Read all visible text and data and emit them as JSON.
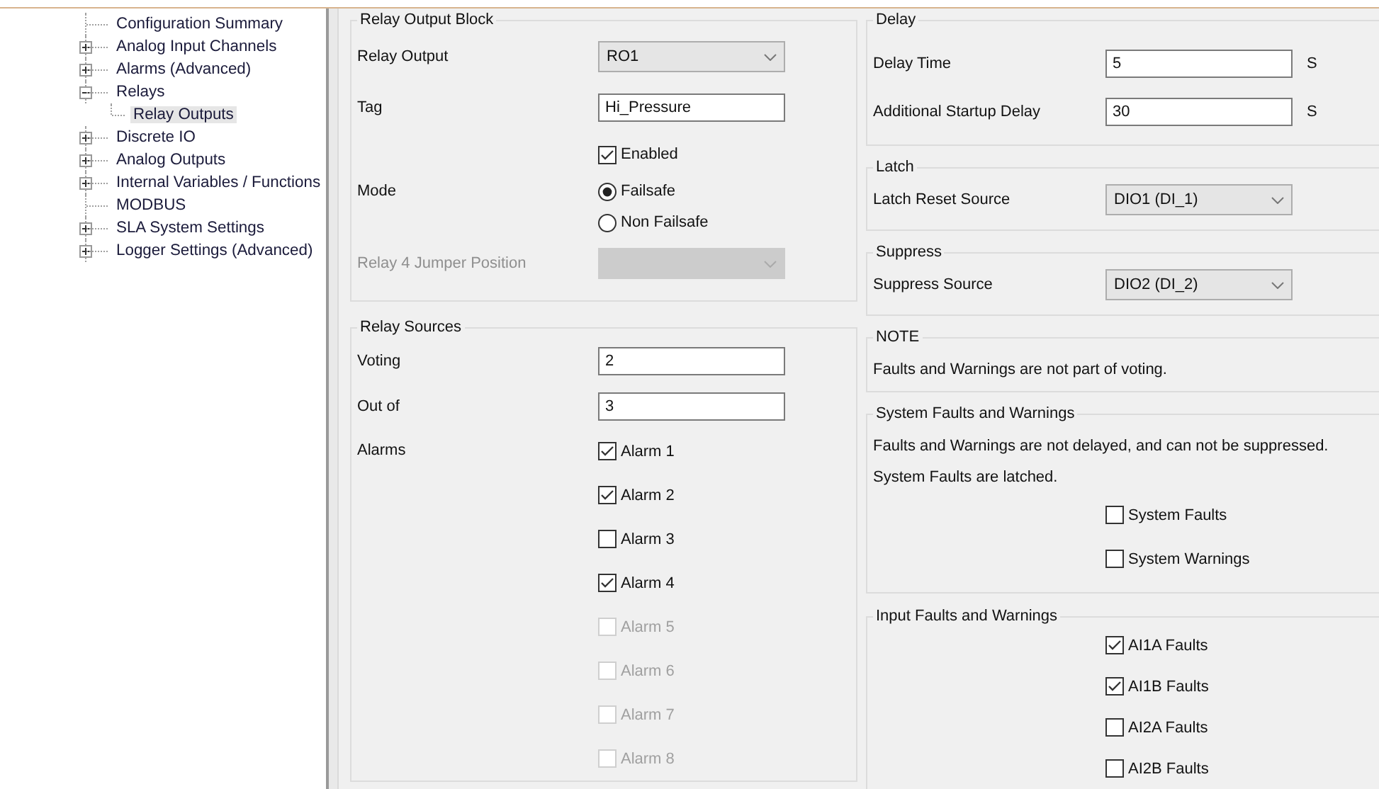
{
  "tree": [
    {
      "label": "Configuration Summary",
      "kind": "leaf",
      "selected": false
    },
    {
      "label": "Analog Input Channels",
      "kind": "node",
      "expanded": false,
      "selected": false
    },
    {
      "label": "Alarms (Advanced)",
      "kind": "node",
      "expanded": false,
      "selected": false
    },
    {
      "label": "Relays",
      "kind": "node",
      "expanded": true,
      "selected": false,
      "children": [
        {
          "label": "Relay Outputs",
          "kind": "leaf",
          "selected": true
        }
      ]
    },
    {
      "label": "Discrete IO",
      "kind": "node",
      "expanded": false,
      "selected": false
    },
    {
      "label": "Analog Outputs",
      "kind": "node",
      "expanded": false,
      "selected": false
    },
    {
      "label": "Internal Variables / Functions",
      "kind": "node",
      "expanded": false,
      "selected": false
    },
    {
      "label": "MODBUS",
      "kind": "leaf",
      "selected": false
    },
    {
      "label": "SLA System Settings",
      "kind": "node",
      "expanded": false,
      "selected": false
    },
    {
      "label": "Logger Settings (Advanced)",
      "kind": "node",
      "expanded": false,
      "selected": false
    }
  ],
  "left_groups": [
    {
      "title": "Relay Output Block",
      "rows": [
        {
          "kind": "select",
          "label": "Relay Output",
          "value": "RO1",
          "disabled": false
        },
        {
          "kind": "text",
          "label": "Tag",
          "value": "Hi_Pressure"
        },
        {
          "kind": "checks",
          "items": [
            {
              "text": "Enabled",
              "checked": true,
              "disabled": false
            }
          ]
        },
        {
          "kind": "radio",
          "label": "Mode",
          "options": [
            {
              "text": "Failsafe",
              "selected": true
            },
            {
              "text": "Non Failsafe",
              "selected": false
            }
          ]
        },
        {
          "kind": "select",
          "label": "Relay 4 Jumper Position",
          "disabled": true
        }
      ]
    },
    {
      "title": "Relay Sources",
      "rows": [
        {
          "kind": "text",
          "label": "Voting",
          "value": "2"
        },
        {
          "kind": "text",
          "label": "Out of",
          "value": "3"
        },
        {
          "kind": "checks",
          "label": "Alarms",
          "items": [
            {
              "text": "Alarm 1",
              "checked": true,
              "disabled": false
            },
            {
              "text": "Alarm 2",
              "checked": true,
              "disabled": false
            },
            {
              "text": "Alarm 3",
              "checked": false,
              "disabled": false
            },
            {
              "text": "Alarm 4",
              "checked": true,
              "disabled": false
            },
            {
              "text": "Alarm 5",
              "checked": false,
              "disabled": true
            },
            {
              "text": "Alarm 6",
              "checked": false,
              "disabled": true
            },
            {
              "text": "Alarm 7",
              "checked": false,
              "disabled": true
            },
            {
              "text": "Alarm 8",
              "checked": false,
              "disabled": true
            }
          ]
        }
      ]
    }
  ],
  "right_groups": [
    {
      "title": "Delay",
      "rows": [
        {
          "kind": "text",
          "label": "Delay Time",
          "value": "5",
          "unit": "S"
        },
        {
          "kind": "text",
          "label": "Additional Startup Delay",
          "value": "30",
          "unit": "S"
        }
      ]
    },
    {
      "title": "Latch",
      "rows": [
        {
          "kind": "select",
          "label": "Latch Reset Source",
          "value": "DIO1 (DI_1)",
          "disabled": false
        }
      ]
    },
    {
      "title": "Suppress",
      "rows": [
        {
          "kind": "select",
          "label": "Suppress Source",
          "value": "DIO2 (DI_2)",
          "disabled": false
        }
      ]
    },
    {
      "title": "NOTE",
      "rows": [
        {
          "kind": "note",
          "text": "Faults and Warnings are not part of voting."
        }
      ]
    },
    {
      "title": "System Faults and Warnings",
      "rows": [
        {
          "kind": "note",
          "text": "Faults and Warnings are not delayed, and can not be suppressed."
        },
        {
          "kind": "note",
          "text": "System Faults are latched."
        },
        {
          "kind": "checks",
          "items": [
            {
              "text": "System Faults",
              "checked": false,
              "disabled": false
            },
            {
              "text": "System Warnings",
              "checked": false,
              "disabled": false
            }
          ]
        }
      ]
    },
    {
      "title": "Input Faults and Warnings",
      "rows": [
        {
          "kind": "checks",
          "items": [
            {
              "text": "AI1A Faults",
              "checked": true,
              "disabled": false
            },
            {
              "text": "AI1B Faults",
              "checked": true,
              "disabled": false
            },
            {
              "text": "AI2A Faults",
              "checked": false,
              "disabled": false
            },
            {
              "text": "AI2B Faults",
              "checked": false,
              "disabled": false
            }
          ]
        }
      ]
    }
  ]
}
